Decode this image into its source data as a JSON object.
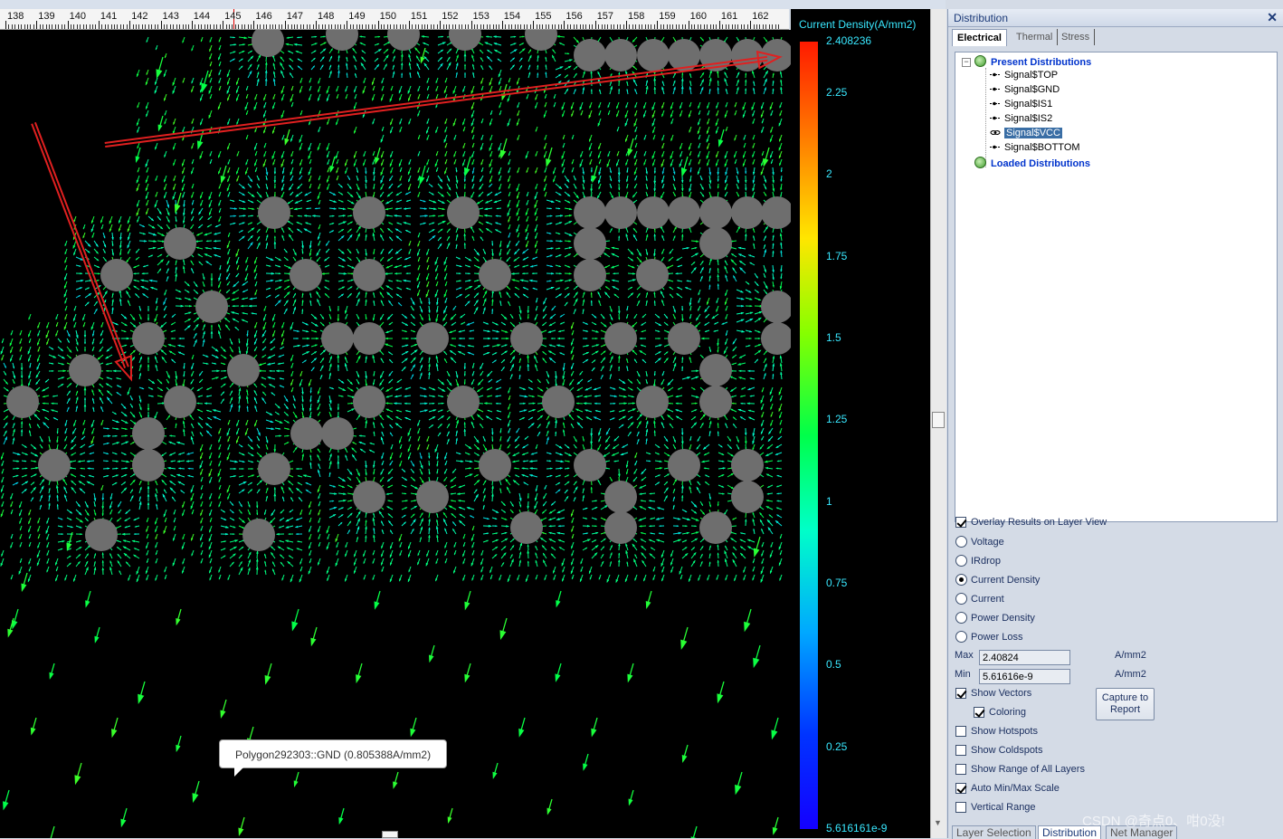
{
  "ruler": {
    "labels": [
      "138",
      "139",
      "140",
      "141",
      "142",
      "143",
      "144",
      "145",
      "146",
      "147",
      "148",
      "149",
      "150",
      "151",
      "152",
      "153",
      "154",
      "155",
      "156",
      "157",
      "158",
      "159",
      "160",
      "161",
      "162"
    ]
  },
  "canvas": {
    "tooltip": "Polygon292303::GND (0.805388A/mm2)"
  },
  "legend": {
    "title": "Current Density(A/mm2)",
    "max_label": "2.408236",
    "min_label": "5.616161e-9",
    "ticks": [
      "2.25",
      "2",
      "1.75",
      "1.5",
      "1.25",
      "1",
      "0.75",
      "0.5",
      "0.25"
    ],
    "ticks_values": [
      2.25,
      2,
      1.75,
      1.5,
      1.25,
      1,
      0.75,
      0.5,
      0.25
    ],
    "min": 5.616161e-09,
    "max": 2.408236
  },
  "panel": {
    "title": "Distribution",
    "close": "✕",
    "tabs": [
      "Electrical",
      "Thermal",
      "Stress"
    ],
    "tree": {
      "present": "Present Distributions",
      "signals": [
        "Signal$TOP",
        "Signal$GND",
        "Signal$IS1",
        "Signal$IS2",
        "Signal$VCC",
        "Signal$BOTTOM"
      ],
      "selected": "Signal$VCC",
      "loaded": "Loaded Distributions"
    },
    "overlay": "Overlay Results on Layer View",
    "radios": [
      "Voltage",
      "IRdrop",
      "Current Density",
      "Current",
      "Power Density",
      "Power Loss"
    ],
    "radio_selected": "Current Density",
    "max_label": "Max",
    "max_value": "2.40824",
    "min_label": "Min",
    "min_value": "5.61616e-9",
    "unit": "A/mm2",
    "show_vectors": "Show Vectors",
    "coloring": "Coloring",
    "capture": "Capture to Report",
    "checks": [
      {
        "label": "Show Hotspots",
        "checked": false
      },
      {
        "label": "Show Coldspots",
        "checked": false
      },
      {
        "label": "Show Range of All Layers",
        "checked": false
      },
      {
        "label": "Auto Min/Max Scale",
        "checked": true
      },
      {
        "label": "Vertical Range",
        "checked": false
      }
    ],
    "bottom_tabs": [
      "Layer Selection",
      "Distribution",
      "Net Manager"
    ]
  },
  "watermark": "CSDN @奇点0、咁0没!",
  "colors": {
    "legend_text": "#39e8ff",
    "annotation_arrow": "#e02020",
    "via": "#6e6e6e"
  }
}
